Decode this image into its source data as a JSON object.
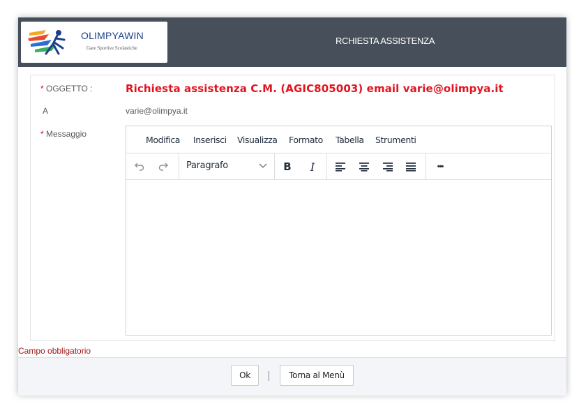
{
  "header": {
    "logo_name": "OLIMPYAWIN",
    "logo_tagline": "Gare Sportive Scolastiche",
    "title": "RCHIESTA ASSISTENZA"
  },
  "form": {
    "subject_label": "OGGETTO :",
    "subject_value": "Richiesta assistenza C.M. (AGIC805003) email varie@olimpya.it",
    "to_label": "A",
    "to_value": "varie@olimpya.it",
    "message_label": "Messaggio",
    "required_marker": "*"
  },
  "editor": {
    "menu": [
      "Modifica",
      "Inserisci",
      "Visualizza",
      "Formato",
      "Tabella",
      "Strumenti"
    ],
    "block_format": "Paragrafo",
    "bold_label": "B",
    "italic_label": "I",
    "more_label": "•••",
    "content": ""
  },
  "required_note": "Campo obbligatorio",
  "footer": {
    "ok_label": "Ok",
    "back_label": "Torna al Menù"
  },
  "colors": {
    "header_bg": "#47505a",
    "subject_red": "#e3121e",
    "required_red": "#d0021b"
  }
}
